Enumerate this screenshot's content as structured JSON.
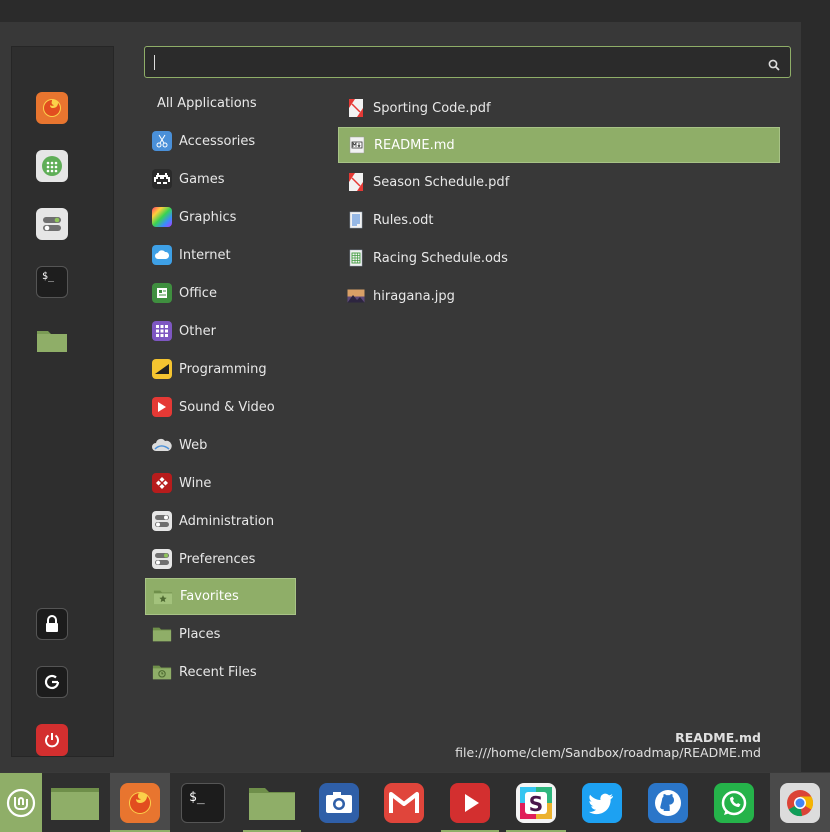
{
  "search": {
    "value": "",
    "placeholder": ""
  },
  "categories_header": "All Applications",
  "categories": [
    {
      "label": "Accessories",
      "icon": "scissors-icon"
    },
    {
      "label": "Games",
      "icon": "invader-icon"
    },
    {
      "label": "Graphics",
      "icon": "palette-icon"
    },
    {
      "label": "Internet",
      "icon": "cloud-icon"
    },
    {
      "label": "Office",
      "icon": "office-icon"
    },
    {
      "label": "Other",
      "icon": "grid-icon"
    },
    {
      "label": "Programming",
      "icon": "ruler-icon"
    },
    {
      "label": "Sound & Video",
      "icon": "play-icon"
    },
    {
      "label": "Web",
      "icon": "web-cloud-icon"
    },
    {
      "label": "Wine",
      "icon": "wine-icon"
    },
    {
      "label": "Administration",
      "icon": "toggles-icon"
    },
    {
      "label": "Preferences",
      "icon": "toggles-icon"
    },
    {
      "label": "Favorites",
      "icon": "favorites-folder-icon",
      "selected": true
    },
    {
      "label": "Places",
      "icon": "folder-icon"
    },
    {
      "label": "Recent Files",
      "icon": "recent-folder-icon"
    }
  ],
  "files": [
    {
      "name": "Sporting Code.pdf",
      "icon": "pdf-icon"
    },
    {
      "name": "README.md",
      "icon": "markdown-icon",
      "selected": true
    },
    {
      "name": "Season Schedule.pdf",
      "icon": "pdf-icon"
    },
    {
      "name": "Rules.odt",
      "icon": "document-icon"
    },
    {
      "name": "Racing Schedule.ods",
      "icon": "spreadsheet-icon"
    },
    {
      "name": "hiragana.jpg",
      "icon": "image-icon"
    }
  ],
  "selection_info": {
    "name": "README.md",
    "path": "file:///home/clem/Sandbox/roadmap/README.md"
  },
  "sidebar": {
    "favorites": [
      "firefox-icon",
      "calculator-icon",
      "settings-icon",
      "terminal-icon",
      "files-icon"
    ],
    "session": [
      "lock-icon",
      "logout-icon",
      "power-icon"
    ]
  },
  "taskbar": [
    "mint-menu-icon",
    "show-desktop-icon",
    "firefox-icon",
    "terminal-icon",
    "files-icon",
    "camera-icon",
    "gmail-icon",
    "youtube-icon",
    "slack-icon",
    "twitter-icon",
    "github-icon",
    "whatsapp-icon",
    "chrome-icon"
  ],
  "colors": {
    "accent": "#8fae68",
    "menu_bg": "#383838",
    "sidebar_bg": "#2e2e2e"
  }
}
